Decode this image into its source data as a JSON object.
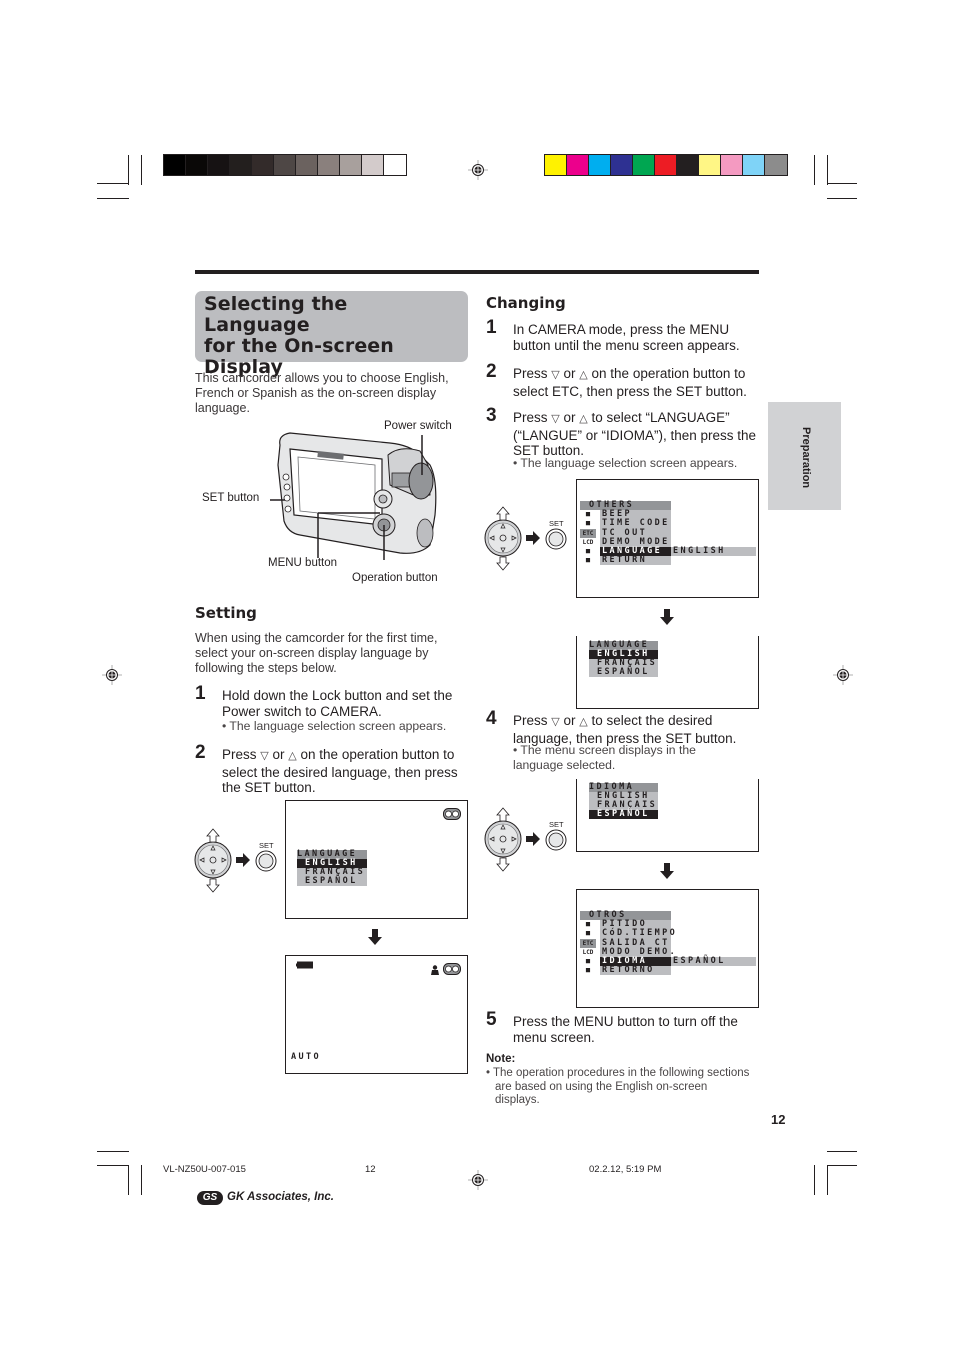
{
  "print_marks": {
    "gray_swatches": [
      "#000000",
      "#0a0807",
      "#161213",
      "#231f1e",
      "#332b2a",
      "#4e4745",
      "#6b625f",
      "#8a807d",
      "#a8a09d",
      "#d3cbcb",
      "#ffffff"
    ],
    "color_swatches": [
      "#fff200",
      "#ec008c",
      "#00aeef",
      "#2e3192",
      "#00a651",
      "#ed1c24",
      "#231f20",
      "#fff685",
      "#f49ac1",
      "#7fd3f7",
      "#8c8c8c"
    ]
  },
  "title": {
    "line1": "Selecting the Language",
    "line2": "for the On-screen",
    "line3": "Display"
  },
  "intro": "This camcorder allows you to choose English, French or Spanish as the on-screen display language.",
  "camera_labels": {
    "power_switch": "Power switch",
    "set_button": "SET button",
    "menu_button": "MENU button",
    "operation_button": "Operation button"
  },
  "setting": {
    "heading": "Setting",
    "intro": "When using the camcorder for the first time, select your on-screen display language by following the steps below.",
    "steps": [
      {
        "num": "1",
        "text": "Hold down the Lock button and set the Power switch to CAMERA.",
        "bullet": "• The language selection screen appears."
      },
      {
        "num": "2",
        "text_a": "Press",
        "down": "▽",
        "or": "or",
        "up": "△",
        "text_b": "on the operation button to select the desired language, then press the SET button."
      }
    ],
    "set_label": "SET",
    "screen1": {
      "title": "LANGUAGE",
      "options": [
        "ENGLISH",
        "FRANÇAIS",
        "ESPAÑOL"
      ],
      "selected": "ENGLISH"
    },
    "screen2": {
      "mode": "AUTO"
    }
  },
  "changing": {
    "heading": "Changing",
    "steps": [
      {
        "num": "1",
        "text": "In CAMERA mode, press the MENU button until the menu screen appears."
      },
      {
        "num": "2",
        "text_a": "Press",
        "down": "▽",
        "or": "or",
        "up": "△",
        "text_b": "on the operation button to select ETC, then press the SET button."
      },
      {
        "num": "3",
        "text_a": "Press",
        "down": "▽",
        "or": "or",
        "up": "△",
        "text_b": "to select “LANGUAGE” (“LANGUE” or “IDIOMA”), then press the SET button.",
        "bullet": "• The language selection screen appears."
      },
      {
        "num": "4",
        "text_a": "Press",
        "down": "▽",
        "or": "or",
        "up": "△",
        "text_b": "to select the desired language, then press the SET button.",
        "bullet": "• The menu screen displays in the language selected."
      },
      {
        "num": "5",
        "text": "Press the MENU button to turn off the menu screen."
      }
    ],
    "set_label": "SET",
    "menu_en": {
      "title": "OTHERS",
      "items": [
        "BEEP",
        "TIME CODE",
        "TC OUT",
        "DEMO MODE",
        "LANGUAGE",
        "RETURN"
      ],
      "selected": "LANGUAGE",
      "value": "ENGLISH",
      "icons": [
        "camera-icon",
        "playback-icon",
        "etc-icon",
        "lcd-icon",
        "clock-icon",
        "return-icon"
      ],
      "icon_labels": [
        "",
        "",
        "ETC",
        "LCD",
        "",
        ""
      ]
    },
    "lang_en": {
      "title": "LANGUAGE",
      "options": [
        "ENGLISH",
        "FRANÇAIS",
        "ESPAÑOL"
      ],
      "selected": "ENGLISH"
    },
    "lang_es": {
      "title": "IDIOMA",
      "options": [
        "ENGLISH",
        "FRANÇAIS",
        "ESPAÑOL"
      ],
      "selected": "ESPAÑOL"
    },
    "menu_es": {
      "title": "OTROS",
      "items": [
        "PITIDO",
        "CóD.TIEMPO",
        "SALIDA CT",
        "MODO DEMO.",
        "IDIOMA",
        "RETORNO"
      ],
      "selected": "IDIOMA",
      "value": "ESPAÑOL",
      "icon_labels": [
        "",
        "",
        "ETC",
        "LCD",
        "",
        ""
      ]
    },
    "note_label": "Note:",
    "note": "• The operation procedures in the following sections are based on using the English on-screen displays."
  },
  "side_tab": "Preparation",
  "page_number": "12",
  "footer": {
    "doc_id": "VL-NZ50U-007-015",
    "page": "12",
    "datetime": "02.2.12, 5:19 PM",
    "publisher": "GK Associates, Inc.",
    "publisher_logo": "GS"
  }
}
